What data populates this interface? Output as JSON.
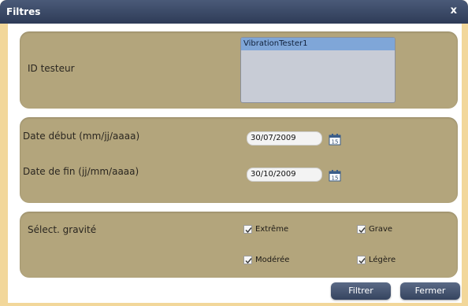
{
  "window": {
    "title": "Filtres",
    "close_label": "x"
  },
  "tester": {
    "label": "ID testeur",
    "items": [
      "VibrationTester1"
    ]
  },
  "dates": {
    "start_label": "Date début (mm/jj/aaaa)",
    "start_value": "30/07/2009",
    "end_label": "Date de fin (jj/mm/aaaa)",
    "end_value": "30/10/2009",
    "calendar_icon_text": "15"
  },
  "severity": {
    "label": "Sélect. gravité",
    "options": [
      {
        "label": "Extrême",
        "checked": true
      },
      {
        "label": "Grave",
        "checked": true
      },
      {
        "label": "Modérée",
        "checked": true
      },
      {
        "label": "Légère",
        "checked": true
      }
    ]
  },
  "buttons": {
    "filter": "Filtrer",
    "close": "Fermer"
  },
  "colors": {
    "titlebar": "#2e3b57",
    "panel": "#b3a57c",
    "frame": "#f2d79a",
    "selection": "#7fa6d8"
  }
}
